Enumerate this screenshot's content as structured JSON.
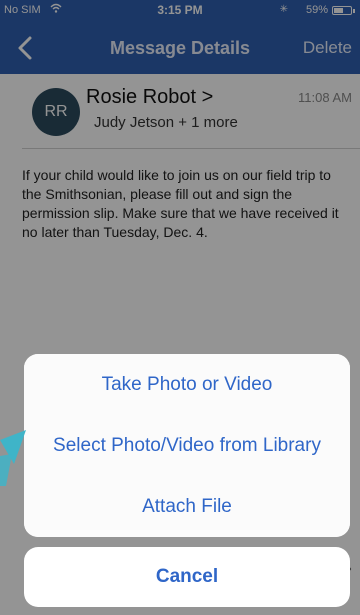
{
  "status_bar": {
    "carrier": "No SIM",
    "time": "3:15 PM",
    "bluetooth": "✳",
    "battery_percent": "59%",
    "battery_level": 0.59
  },
  "nav": {
    "title": "Message Details",
    "delete_label": "Delete"
  },
  "message": {
    "avatar_initials": "RR",
    "sender": "Rosie Robot >",
    "recipients": "Judy Jetson + 1 more",
    "time": "11:08 AM",
    "body": "If your child would like to join us on our field trip to the Smithsonian, please fill out and sign the permission slip. Make sure that we have received it no later than Tuesday, Dec. 4."
  },
  "action_sheet": {
    "options": [
      {
        "label": "Take Photo or Video"
      },
      {
        "label": "Select Photo/Video from Library"
      },
      {
        "label": "Attach File"
      }
    ],
    "cancel_label": "Cancel"
  },
  "colors": {
    "nav_bar": "#2f5fb0",
    "action_text": "#2f66c8",
    "avatar": "#2b4a5d",
    "pointer_arrow": "#3fb4c8"
  }
}
